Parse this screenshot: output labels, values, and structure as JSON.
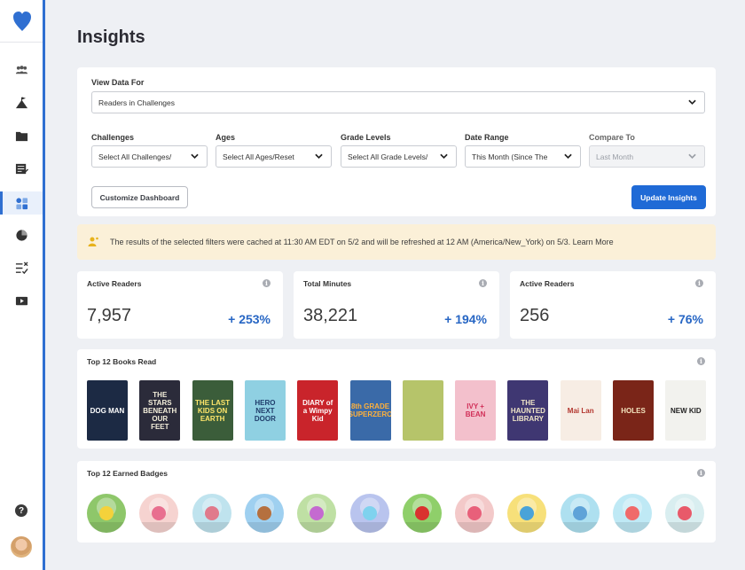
{
  "page": {
    "title": "Insights"
  },
  "sidebar": {
    "items": [
      {
        "icon": "people-icon"
      },
      {
        "icon": "mountain-flag-icon"
      },
      {
        "icon": "folder-icon"
      },
      {
        "icon": "reading-log-icon"
      },
      {
        "icon": "dashboard-icon",
        "active": true
      },
      {
        "icon": "pie-chart-icon"
      },
      {
        "icon": "checklist-icon"
      },
      {
        "icon": "video-icon"
      }
    ],
    "help_label": "?"
  },
  "filters": {
    "view_data_for_label": "View Data For",
    "view_data_for_value": "Readers in Challenges",
    "challenges_label": "Challenges",
    "challenges_value": "Select All Challenges/",
    "ages_label": "Ages",
    "ages_value": "Select All Ages/Reset",
    "grade_levels_label": "Grade Levels",
    "grade_levels_value": "Select All Grade Levels/",
    "date_range_label": "Date Range",
    "date_range_value": "This Month (Since The",
    "compare_to_label": "Compare To",
    "compare_to_value": "Last Month",
    "customize_button": "Customize Dashboard",
    "update_button": "Update Insights"
  },
  "notice": {
    "text": "The results of the selected filters were cached at 11:30 AM EDT on 5/2 and will be refreshed at 12 AM (America/New_York) on 5/3. Learn More"
  },
  "stats": [
    {
      "title": "Active Readers",
      "value": "7,957",
      "change": "+ 253%"
    },
    {
      "title": "Total Minutes",
      "value": "38,221",
      "change": "+ 194%"
    },
    {
      "title": "Active Readers",
      "value": "256",
      "change": "+ 76%"
    }
  ],
  "books": {
    "title": "Top 12 Books Read",
    "items": [
      {
        "cover_text": "DOG MAN",
        "bg": "#1c2a44",
        "fg": "#ffffff"
      },
      {
        "cover_text": "THE STARS BENEATH OUR FEET",
        "bg": "#2b2b3a",
        "fg": "#f5f0dc"
      },
      {
        "cover_text": "THE LAST KIDS ON EARTH",
        "bg": "#3b5d3a",
        "fg": "#ffe66a"
      },
      {
        "cover_text": "HERO NEXT DOOR",
        "bg": "#8fd0e2",
        "fg": "#1f3d6b"
      },
      {
        "cover_text": "DIARY of a Wimpy Kid",
        "bg": "#c9242b",
        "fg": "#ffffff"
      },
      {
        "cover_text": "8th GRADE SUPERZERO",
        "bg": "#3a6aa8",
        "fg": "#ffb13b"
      },
      {
        "cover_text": "",
        "bg": "#b6c46a",
        "fg": "#2a2a2a"
      },
      {
        "cover_text": "IVY + BEAN",
        "bg": "#f3c0cc",
        "fg": "#d12f58"
      },
      {
        "cover_text": "THE HAUNTED LIBRARY",
        "bg": "#3f3772",
        "fg": "#f0e6c8"
      },
      {
        "cover_text": "Mai Lan",
        "bg": "#f7ede4",
        "fg": "#b3362e"
      },
      {
        "cover_text": "HOLES",
        "bg": "#7a2518",
        "fg": "#f5e6c0"
      },
      {
        "cover_text": "NEW KID",
        "bg": "#f2f2ee",
        "fg": "#222222"
      }
    ]
  },
  "badges": {
    "title": "Top 12 Earned Badges",
    "items": [
      {
        "name": "chicks-badge",
        "bg": "#8ec76a",
        "accent": "#f4d23b"
      },
      {
        "name": "flower-bee-badge",
        "bg": "#f6d3d0",
        "accent": "#e86f8f"
      },
      {
        "name": "bird-blossom-badge",
        "bg": "#bfe3ee",
        "accent": "#e07a8c"
      },
      {
        "name": "birdhouse-badge",
        "bg": "#9fd0f0",
        "accent": "#b5703f"
      },
      {
        "name": "flower-pots-badge",
        "bg": "#bfe0a4",
        "accent": "#c46ad0"
      },
      {
        "name": "crystal-badge",
        "bg": "#b9c4ee",
        "accent": "#7fd2ee"
      },
      {
        "name": "ladybug-badge",
        "bg": "#8fcf6a",
        "accent": "#d9322f"
      },
      {
        "name": "mushroom-badge",
        "bg": "#f3c9c9",
        "accent": "#e8607a"
      },
      {
        "name": "pinwheel-badge",
        "bg": "#f7e07a",
        "accent": "#4aa3d8"
      },
      {
        "name": "rain-cloud-badge",
        "bg": "#aee0f0",
        "accent": "#5fa3d8"
      },
      {
        "name": "rainbow-badge",
        "bg": "#bfe9f5",
        "accent": "#f06a6a"
      },
      {
        "name": "flowers-badge",
        "bg": "#d9eef0",
        "accent": "#e85a6a"
      }
    ]
  },
  "colors": {
    "accent": "#1f6ad6",
    "positive": "#2766c4",
    "notice_bg": "#fbf0d8"
  }
}
